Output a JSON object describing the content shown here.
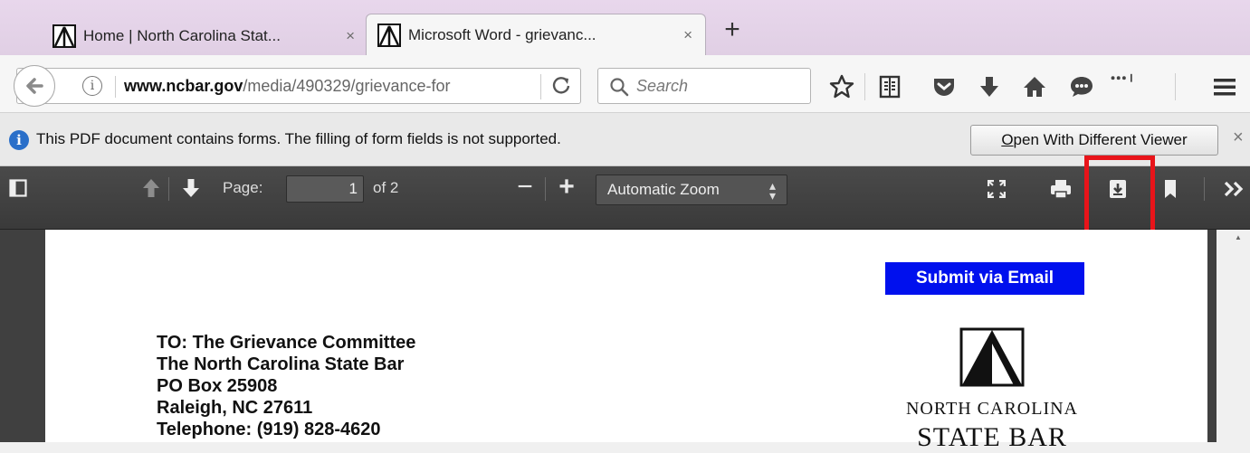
{
  "tabs": [
    {
      "title": "Home | North Carolina Stat...",
      "close": "×"
    },
    {
      "title": "Microsoft Word - grievanc...",
      "close": "×"
    }
  ],
  "new_tab": "+",
  "nav": {
    "url_domain": "www.ncbar.gov",
    "url_path": "/media/490329/grievance-for",
    "search_placeholder": "Search"
  },
  "notification": {
    "message": "This PDF document contains forms. The filling of form fields is not supported.",
    "button_first": "O",
    "button_rest": "pen With Different Viewer",
    "close": "×"
  },
  "pdf_toolbar": {
    "page_label": "Page:",
    "page_value": "1",
    "page_of": "of 2",
    "zoom_label": "Automatic Zoom",
    "zoom_minus": "−",
    "zoom_plus": "+"
  },
  "document": {
    "submit_label": "Submit via Email",
    "address_lines": [
      "TO: The Grievance Committee",
      "The North Carolina State Bar",
      "PO Box 25908",
      "Raleigh, NC 27611",
      "Telephone: (919) 828-4620"
    ],
    "org_line1": "NORTH CAROLINA",
    "org_line2": "STATE BAR"
  },
  "colors": {
    "highlight": "#e8141a",
    "submit_bg": "#0010ee",
    "info_blue": "#2a6fc9"
  }
}
